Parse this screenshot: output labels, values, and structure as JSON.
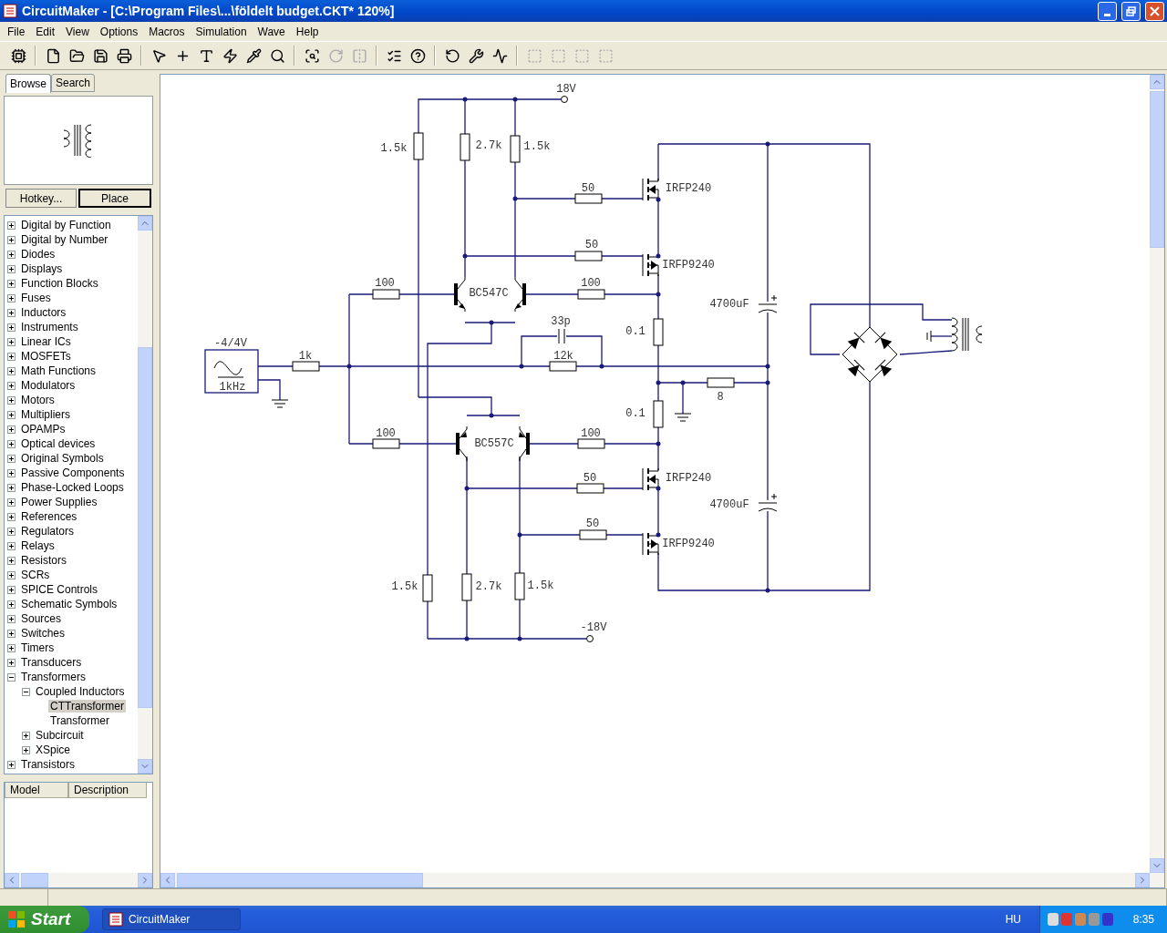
{
  "window": {
    "title": "CircuitMaker - [C:\\Program Files\\...\\földelt budget.CKT* 120%]"
  },
  "menu": [
    "File",
    "Edit",
    "View",
    "Options",
    "Macros",
    "Simulation",
    "Wave",
    "Help"
  ],
  "panel": {
    "tabs": [
      {
        "label": "Browse",
        "selected": true
      },
      {
        "label": "Search",
        "selected": false
      }
    ],
    "buttons": [
      "Hotkey...",
      "Place"
    ],
    "tree": [
      {
        "label": "Digital by Function",
        "kind": "group",
        "expanded": false,
        "selected": false
      },
      {
        "label": "Digital by Number",
        "kind": "group",
        "expanded": false,
        "selected": false
      },
      {
        "label": "Diodes",
        "kind": "group",
        "expanded": false,
        "selected": false
      },
      {
        "label": "Displays",
        "kind": "group",
        "expanded": false,
        "selected": false
      },
      {
        "label": "Function Blocks",
        "kind": "group",
        "expanded": false,
        "selected": false
      },
      {
        "label": "Fuses",
        "kind": "group",
        "expanded": false,
        "selected": false
      },
      {
        "label": "Inductors",
        "kind": "group",
        "expanded": false,
        "selected": false
      },
      {
        "label": "Instruments",
        "kind": "group",
        "expanded": false,
        "selected": false
      },
      {
        "label": "Linear ICs",
        "kind": "group",
        "expanded": false,
        "selected": false
      },
      {
        "label": "MOSFETs",
        "kind": "group",
        "expanded": false,
        "selected": false
      },
      {
        "label": "Math Functions",
        "kind": "group",
        "expanded": false,
        "selected": false
      },
      {
        "label": "Modulators",
        "kind": "group",
        "expanded": false,
        "selected": false
      },
      {
        "label": "Motors",
        "kind": "group",
        "expanded": false,
        "selected": false
      },
      {
        "label": "Multipliers",
        "kind": "group",
        "expanded": false,
        "selected": false
      },
      {
        "label": "OPAMPs",
        "kind": "group",
        "expanded": false,
        "selected": false
      },
      {
        "label": "Optical devices",
        "kind": "group",
        "expanded": false,
        "selected": false
      },
      {
        "label": "Original Symbols",
        "kind": "group",
        "expanded": false,
        "selected": false
      },
      {
        "label": "Passive Components",
        "kind": "group",
        "expanded": false,
        "selected": false
      },
      {
        "label": "Phase-Locked Loops",
        "kind": "group",
        "expanded": false,
        "selected": false
      },
      {
        "label": "Power Supplies",
        "kind": "group",
        "expanded": false,
        "selected": false
      },
      {
        "label": "References",
        "kind": "group",
        "expanded": false,
        "selected": false
      },
      {
        "label": "Regulators",
        "kind": "group",
        "expanded": false,
        "selected": false
      },
      {
        "label": "Relays",
        "kind": "group",
        "expanded": false,
        "selected": false
      },
      {
        "label": "Resistors",
        "kind": "group",
        "expanded": false,
        "selected": false
      },
      {
        "label": "SCRs",
        "kind": "group",
        "expanded": false,
        "selected": false
      },
      {
        "label": "SPICE Controls",
        "kind": "group",
        "expanded": false,
        "selected": false
      },
      {
        "label": "Schematic Symbols",
        "kind": "group",
        "expanded": false,
        "selected": false
      },
      {
        "label": "Sources",
        "kind": "group",
        "expanded": false,
        "selected": false
      },
      {
        "label": "Switches",
        "kind": "group",
        "expanded": false,
        "selected": false
      },
      {
        "label": "Timers",
        "kind": "group",
        "expanded": false,
        "selected": false
      },
      {
        "label": "Transducers",
        "kind": "group",
        "expanded": false,
        "selected": false
      },
      {
        "label": "Transformers",
        "kind": "group",
        "expanded": true,
        "selected": false,
        "children": [
          {
            "label": "Coupled Inductors",
            "kind": "group",
            "expanded": true,
            "selected": false,
            "children": [
              {
                "label": "CTTransformer",
                "kind": "leaf",
                "selected": true
              },
              {
                "label": "Transformer",
                "kind": "leaf",
                "selected": false
              }
            ]
          },
          {
            "label": "Subcircuit",
            "kind": "group",
            "expanded": false,
            "selected": false
          },
          {
            "label": "XSpice",
            "kind": "group",
            "expanded": false,
            "selected": false
          }
        ]
      },
      {
        "label": "Transistors",
        "kind": "group",
        "expanded": false,
        "selected": false
      }
    ],
    "columns": [
      "Model",
      "Description"
    ]
  },
  "schematic": {
    "labels": [
      "18V",
      "1.5k",
      "2.7k",
      "1.5k",
      "50",
      "IRFP240",
      "50",
      "IRFP9240",
      "100",
      "BC547C",
      "100",
      "4700uF",
      "0.1",
      "33p",
      "-4/4V",
      "1k",
      "12k",
      "1kHz",
      "8",
      "0.1",
      "100",
      "BC557C",
      "100",
      "50",
      "IRFP240",
      "4700uF",
      "50",
      "IRFP9240",
      "1.5k",
      "2.7k",
      "1.5k",
      "-18V"
    ]
  },
  "taskbar": {
    "start": "Start",
    "tasks": [
      "CircuitMaker"
    ],
    "language": "HU",
    "clock": "8:35"
  }
}
